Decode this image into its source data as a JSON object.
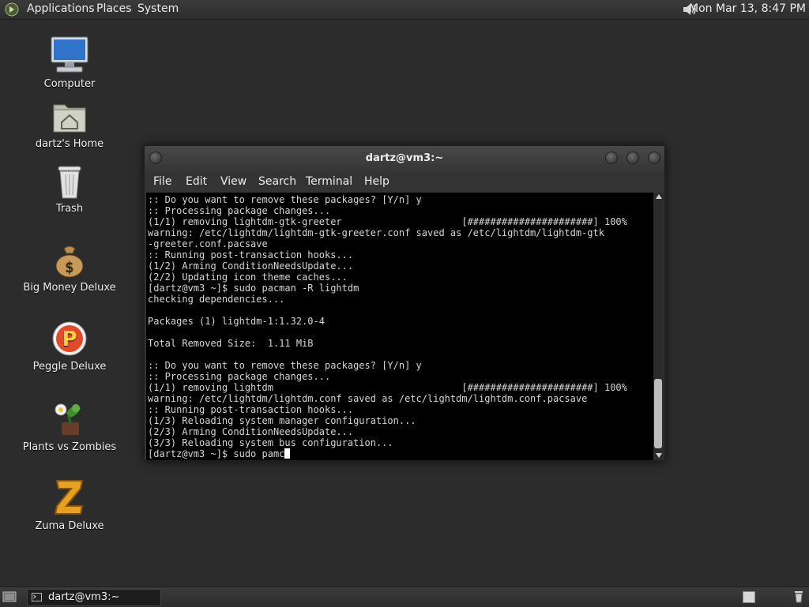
{
  "top_panel": {
    "menus": [
      "Applications",
      "Places",
      "System"
    ],
    "clock": "Mon Mar 13,  8:47 PM",
    "volume_icon": "speaker-icon",
    "apps_icon": "gnome-foot-icon"
  },
  "desktop_icons": [
    {
      "label": "Computer",
      "icon": "computer-icon"
    },
    {
      "label": "dartz's Home",
      "icon": "home-folder-icon"
    },
    {
      "label": "Trash",
      "icon": "trash-icon"
    },
    {
      "label": "Big Money Deluxe",
      "icon": "money-bag-icon"
    },
    {
      "label": "Peggle Deluxe",
      "icon": "peggle-icon"
    },
    {
      "label": "Plants vs Zombies",
      "icon": "plants-vs-zombies-icon"
    },
    {
      "label": "Zuma Deluxe",
      "icon": "zuma-icon"
    }
  ],
  "terminal": {
    "title": "dartz@vm3:~",
    "menu": [
      "File",
      "Edit",
      "View",
      "Search",
      "Terminal",
      "Help"
    ],
    "lines": [
      ":: Do you want to remove these packages? [Y/n] y",
      ":: Processing package changes...",
      "(1/1) removing lightdm-gtk-greeter                     [######################] 100%",
      "warning: /etc/lightdm/lightdm-gtk-greeter.conf saved as /etc/lightdm/lightdm-gtk",
      "-greeter.conf.pacsave",
      ":: Running post-transaction hooks...",
      "(1/2) Arming ConditionNeedsUpdate...",
      "(2/2) Updating icon theme caches...",
      "[dartz@vm3 ~]$ sudo pacman -R lightdm",
      "checking dependencies...",
      "",
      "Packages (1) lightdm-1:1.32.0-4",
      "",
      "Total Removed Size:  1.11 MiB",
      "",
      ":: Do you want to remove these packages? [Y/n] y",
      ":: Processing package changes...",
      "(1/1) removing lightdm                                 [######################] 100%",
      "warning: /etc/lightdm/lightdm.conf saved as /etc/lightdm/lightdm.conf.pacsave",
      ":: Running post-transaction hooks...",
      "(1/3) Reloading system manager configuration...",
      "(2/3) Arming ConditionNeedsUpdate...",
      "(3/3) Reloading system bus configuration..."
    ],
    "prompt_line": "[dartz@vm3 ~]$ sudo pamc"
  },
  "bottom_panel": {
    "task_label": "dartz@vm3:~",
    "show_desktop_icon": "show-desktop-icon",
    "workspace_icon": "workspace-switcher-icon",
    "trash_applet_icon": "trash-applet-icon"
  }
}
